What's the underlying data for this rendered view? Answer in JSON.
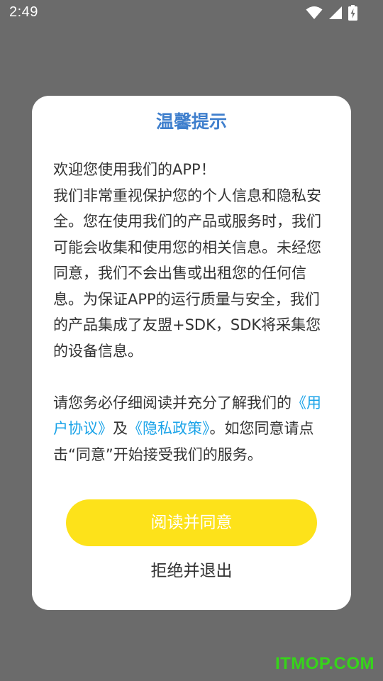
{
  "status_bar": {
    "time": "2:49",
    "icons": [
      "wifi-icon",
      "cellular-signal-icon",
      "battery-charging-icon"
    ]
  },
  "dialog": {
    "title": "温馨提示",
    "body": {
      "line1": "欢迎您使用我们的APP！",
      "paragraph1": "我们非常重视保护您的个人信息和隐私安全。您在使用我们的产品或服务时，我们可能会收集和使用您的相关信息。未经您同意，我们不会出售或出租您的任何信息。为保证APP的运行质量与安全，我们的产品集成了友盟+SDK，SDK将采集您的设备信息。",
      "paragraph2_prefix": "请您务必仔细阅读并充分了解我们的",
      "user_agreement_link": "《用户协议》",
      "and": "及",
      "privacy_policy_link": "《隐私政策》",
      "paragraph2_suffix": "。如您同意请点击“同意”开始接受我们的服务。"
    },
    "agree_label": "阅读并同意",
    "reject_label": "拒绝并退出"
  },
  "watermark": "ITMOP.COM",
  "colors": {
    "overlay": "#6b6b6b",
    "title": "#3f7fcd",
    "link": "#1aa3e8",
    "agree_button": "#fde21a",
    "watermark": "#36d41a"
  }
}
